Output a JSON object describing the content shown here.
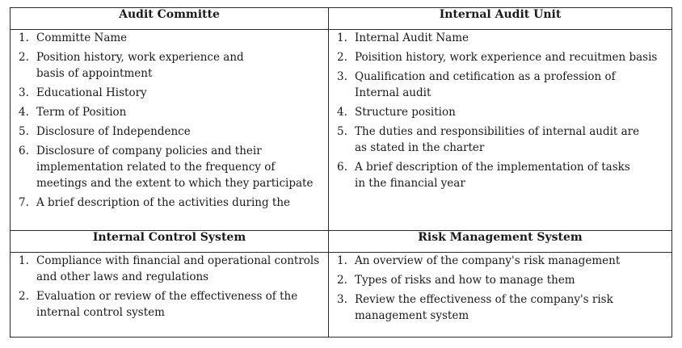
{
  "sections": [
    {
      "title": "Audit Committe",
      "items": [
        "Committe Name",
        "Position history, work experience and\nbasis of appointment",
        "Educational History",
        "Term of Position",
        "Disclosure of Independence",
        "Disclosure of company policies and their\nimplementation related to the frequency of\nmeetings and the extent to which they participate",
        "A brief description of the activities during the"
      ]
    },
    {
      "title": "Internal Audit Unit",
      "items": [
        "Internal Audit Name",
        "Poisition history, work experience and recuitmen basis",
        "Qualification and cetification as a profession of\nInternal audit",
        "Structure position",
        "The duties and responsibilities of internal audit are\nas stated in the charter",
        "A brief description of the implementation of tasks\nin the financial year"
      ]
    },
    {
      "title": "Internal Control System",
      "items": [
        "Compliance with financial and operational controls\nand other laws and regulations",
        "Evaluation or review of the effectiveness of the\ninternal control system"
      ]
    },
    {
      "title": "Risk Management System",
      "items": [
        "An overview of the company's risk management",
        "Types of risks and how to manage them",
        "Review the effectiveness of the company's risk\nmanagement system"
      ]
    }
  ]
}
